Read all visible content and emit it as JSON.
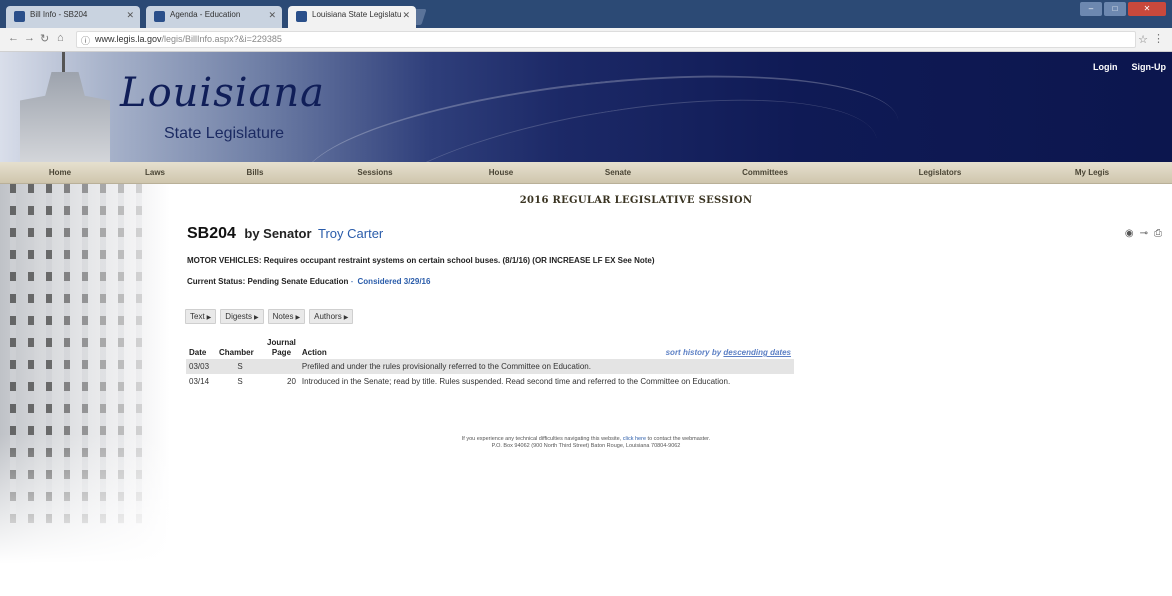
{
  "browser": {
    "tabs": [
      {
        "label": "Bill Info - SB204",
        "active": false
      },
      {
        "label": "Agenda - Education",
        "active": false
      },
      {
        "label": "Louisiana State Legislatu",
        "active": true
      }
    ],
    "url_domain": "www.legis.la.gov",
    "url_path": "/legis/BillInfo.aspx?&i=229385"
  },
  "header": {
    "logo_main": "Louisiana",
    "logo_sub": "State Legislature",
    "login": "Login",
    "signup": "Sign-Up"
  },
  "nav": {
    "items": [
      "Home",
      "Laws",
      "Bills",
      "Sessions",
      "House",
      "Senate",
      "Committees",
      "Legislators",
      "My Legis"
    ]
  },
  "main": {
    "session_title": "2016 REGULAR LEGISLATIVE SESSION",
    "bill_number": "SB204",
    "by_label": "by Senator",
    "author": "Troy Carter",
    "description": "MOTOR VEHICLES: Requires occupant restraint systems on certain school buses. (8/1/16) (OR INCREASE LF EX See Note)",
    "status_label": "Current Status:",
    "status_value": "Pending Senate Education",
    "status_sep": "-",
    "status_considered": "Considered 3/29/16",
    "doc_buttons": [
      "Text",
      "Digests",
      "Notes",
      "Authors"
    ]
  },
  "history": {
    "headers": {
      "date": "Date",
      "chamber": "Chamber",
      "journal_top": "Journal",
      "journal_bottom": "Page",
      "action": "Action"
    },
    "sort_prefix": "sort history by",
    "sort_link": "descending dates",
    "rows": [
      {
        "date": "03/03",
        "chamber": "S",
        "page": "",
        "action": "Prefiled and under the rules provisionally referred to the Committee on Education."
      },
      {
        "date": "03/14",
        "chamber": "S",
        "page": "20",
        "action": "Introduced in the Senate; read by title. Rules suspended. Read second time and referred to the Committee on Education."
      }
    ]
  },
  "footer": {
    "line1_pre": "If you experience any technical difficulties navigating this website,",
    "line1_link": "click here",
    "line1_post": "to contact the webmaster.",
    "line2": "P.O. Box 94062 (900 North Third Street) Baton Rouge, Louisiana 70804-9062"
  }
}
